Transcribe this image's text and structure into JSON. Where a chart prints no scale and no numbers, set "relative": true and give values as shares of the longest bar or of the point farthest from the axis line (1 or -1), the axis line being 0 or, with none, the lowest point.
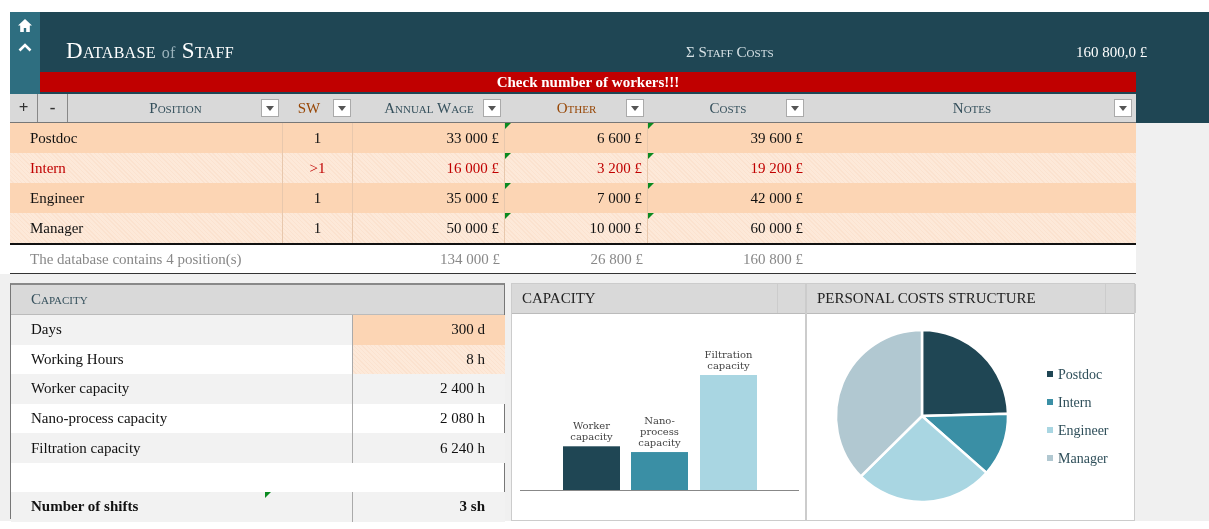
{
  "header": {
    "title_parts": [
      {
        "text": "Database",
        "kind": "main"
      },
      {
        "text": "of",
        "kind": "minor"
      },
      {
        "text": "Staff",
        "kind": "main"
      }
    ],
    "total_label": "Σ  Staff Costs",
    "total_value": "160 800,0 £",
    "alert": "Check number of workers!!!"
  },
  "table": {
    "add_button": "+",
    "remove_button": "-",
    "columns": [
      {
        "label": "Position",
        "color": "#35505c"
      },
      {
        "label": "SW",
        "color": "#974706"
      },
      {
        "label": "Annual Wage",
        "color": "#35505c"
      },
      {
        "label": "Other",
        "color": "#974706"
      },
      {
        "label": "Costs",
        "color": "#35505c"
      },
      {
        "label": "Notes",
        "color": "#35505c"
      }
    ],
    "rows": [
      {
        "position": "Postdoc",
        "sw": "1",
        "annual_wage": "33 000 £",
        "other": "6 600 £",
        "costs": "39 600 £",
        "warning": false,
        "flagged": true
      },
      {
        "position": "Intern",
        "sw": ">1",
        "annual_wage": "16 000 £",
        "other": "3 200 £",
        "costs": "19 200 £",
        "warning": true,
        "flagged": true
      },
      {
        "position": "Engineer",
        "sw": "1",
        "annual_wage": "35 000 £",
        "other": "7 000 £",
        "costs": "42 000 £",
        "warning": false,
        "flagged": true
      },
      {
        "position": "Manager",
        "sw": "1",
        "annual_wage": "50 000 £",
        "other": "10 000 £",
        "costs": "60 000 £",
        "warning": false,
        "flagged": true
      }
    ],
    "totals": {
      "summary": "The database contains 4 position(s)",
      "annual_wage": "134 000 £",
      "other": "26 800 £",
      "costs": "160 800 £"
    }
  },
  "capacity": {
    "title": "Capacity",
    "rows": [
      {
        "label": "Days",
        "value": "300 d",
        "kind": "input"
      },
      {
        "label": "Working Hours",
        "value": "8 h",
        "kind": "input"
      },
      {
        "label": "Worker capacity",
        "value": "2 400 h",
        "kind": "calc"
      },
      {
        "label": "Nano-process capacity",
        "value": "2 080 h",
        "kind": "calc"
      },
      {
        "label": "Filtration capacity",
        "value": "6 240 h",
        "kind": "calc"
      },
      {
        "label": "Number of shifts",
        "value": "3 sh",
        "kind": "total"
      }
    ]
  },
  "capacity_chart": {
    "title": "CAPACITY",
    "chart_data": {
      "type": "bar",
      "categories": [
        "Worker capacity",
        "Nano-process capacity",
        "Filtration capacity"
      ],
      "values": [
        0.38,
        0.33,
        1
      ],
      "relative": true,
      "colors": [
        "#1f4654",
        "#3a8fa5",
        "#a9d6e2"
      ]
    }
  },
  "cost_chart": {
    "title": "PERSONAL COSTS STRUCTURE",
    "chart_data": {
      "type": "pie",
      "categories": [
        "Postdoc",
        "Intern",
        "Engineer",
        "Manager"
      ],
      "values": [
        24.6,
        11.9,
        26.1,
        37.4
      ],
      "legend": "right",
      "colors": [
        "#1f4654",
        "#3a8fa5",
        "#a9d6e2",
        "#b1c8d1"
      ]
    }
  }
}
